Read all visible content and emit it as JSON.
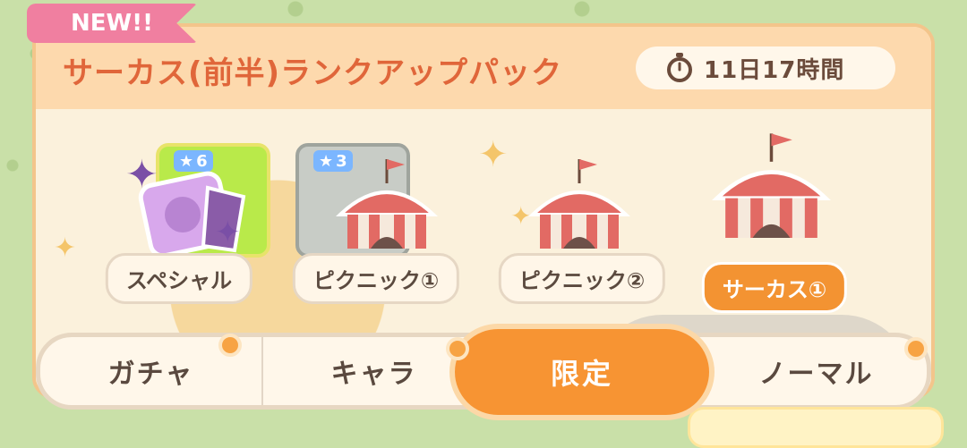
{
  "badge": {
    "label": "NEW!!"
  },
  "pack": {
    "title": "サーカス(前半)ランクアップパック",
    "timer": "11日17時間",
    "timer_icon": "stopwatch-icon"
  },
  "items": [
    {
      "label": "スペシャル",
      "card_badge": "6"
    },
    {
      "label": "ピクニック①",
      "card_badge": "3"
    },
    {
      "label": "ピクニック②"
    },
    {
      "label": "サーカス①"
    }
  ],
  "tabs": [
    {
      "label": "ガチャ"
    },
    {
      "label": "キャラ"
    },
    {
      "label": "限定"
    },
    {
      "label": "ノーマル"
    }
  ],
  "colors": {
    "accent": "#f79433",
    "title": "#e0663a",
    "badge": "#f07fa0"
  }
}
